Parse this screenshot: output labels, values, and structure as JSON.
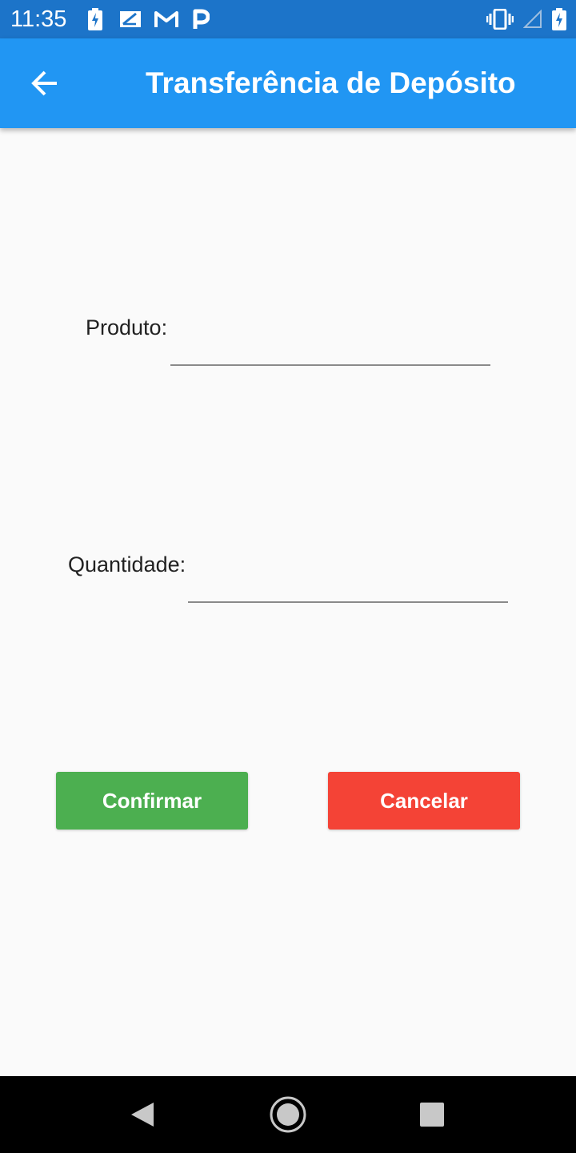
{
  "status_bar": {
    "time": "11:35",
    "left_icons": [
      "battery-charging-icon",
      "sim-card-icon",
      "gmail-icon",
      "parking-icon"
    ],
    "right_icons": [
      "vibrate-icon",
      "signal-icon",
      "battery-charging-icon"
    ]
  },
  "app_bar": {
    "title": "Transferência de Depósito",
    "back_icon": "arrow-left-icon",
    "color": "#2196f3"
  },
  "form": {
    "produto_label": "Produto:",
    "produto_value": "",
    "quantidade_label": "Quantidade:",
    "quantidade_value": ""
  },
  "buttons": {
    "confirm_label": "Confirmar",
    "confirm_color": "#4caf50",
    "cancel_label": "Cancelar",
    "cancel_color": "#f44336"
  },
  "nav_bar": {
    "back_icon": "triangle-back-icon",
    "home_icon": "circle-home-icon",
    "recents_icon": "square-recents-icon"
  }
}
